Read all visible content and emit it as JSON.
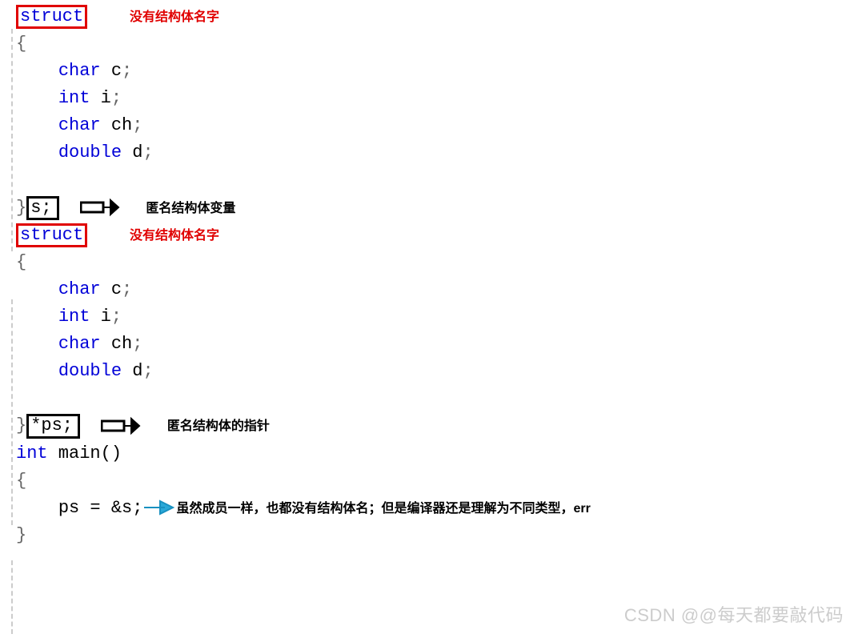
{
  "code": {
    "struct_kw": "struct",
    "open_brace": "{",
    "close_brace": "}",
    "mbr_char_c": "char c;",
    "mbr_int_i": "int i;",
    "mbr_char_ch": "char ch;",
    "mbr_double_d": "double d;",
    "var_s": "s;",
    "var_ps": "*ps;",
    "main_decl": "int main()",
    "main_kw_int": "int",
    "main_rest": " main()",
    "stmt_ps": "ps = &s;",
    "close_main": "}"
  },
  "ann": {
    "no_name": "没有结构体名字",
    "anon_var": "匿名结构体变量",
    "anon_ptr": "匿名结构体的指针",
    "explain": "虽然成员一样，也都没有结构体名；但是编译器还是理解为不同类型，err"
  },
  "watermark": "CSDN @@每天都要敲代码"
}
